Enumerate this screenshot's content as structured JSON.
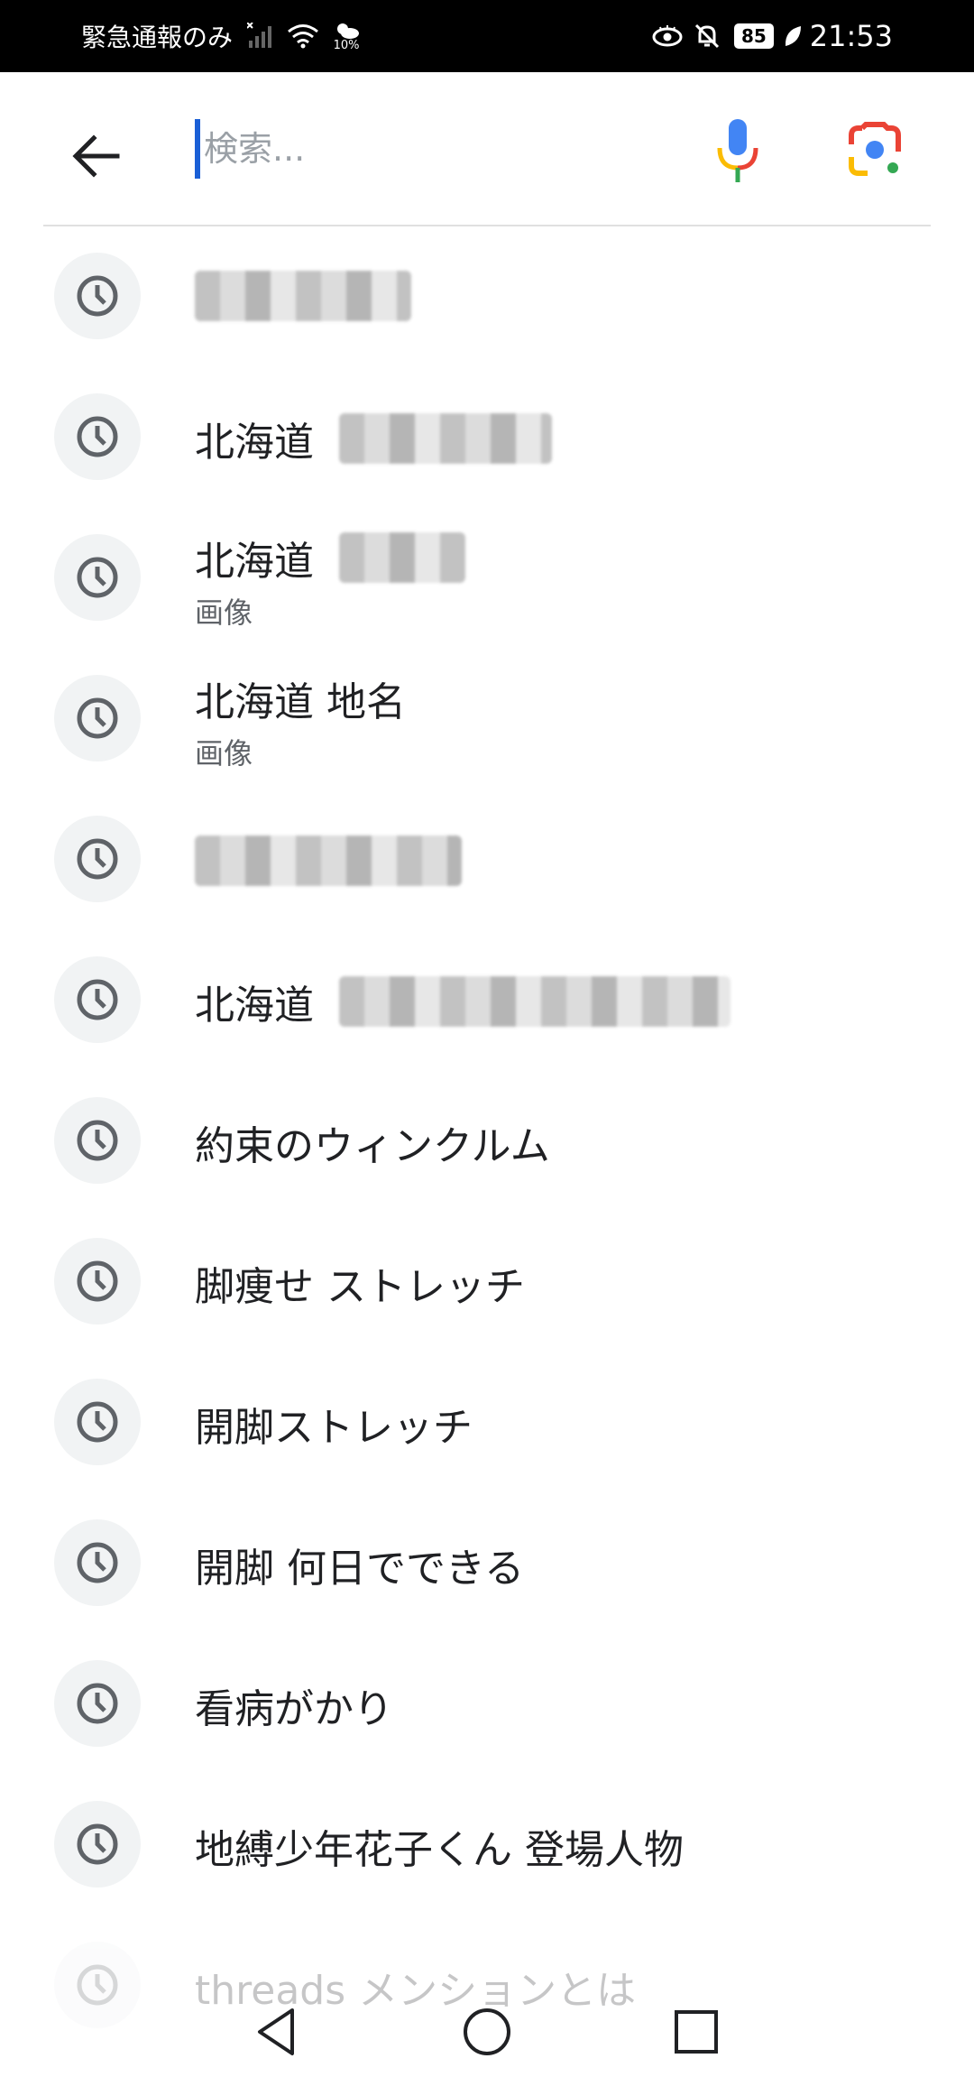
{
  "status_bar": {
    "carrier": "緊急通報のみ",
    "weather_text": "10%",
    "battery": "85",
    "time": "21:53"
  },
  "search": {
    "placeholder": "検索..."
  },
  "history": [
    {
      "text": "",
      "subtitle": ""
    },
    {
      "text": "北海道",
      "subtitle": ""
    },
    {
      "text": "北海道",
      "subtitle": "画像"
    },
    {
      "text": "北海道 地名",
      "subtitle": "画像"
    },
    {
      "text": "",
      "subtitle": ""
    },
    {
      "text": "北海道",
      "subtitle": ""
    },
    {
      "text": "約束のウィンクルム",
      "subtitle": ""
    },
    {
      "text": "脚痩せ ストレッチ",
      "subtitle": ""
    },
    {
      "text": "開脚ストレッチ",
      "subtitle": ""
    },
    {
      "text": "開脚 何日でできる",
      "subtitle": ""
    },
    {
      "text": "看病がかり",
      "subtitle": ""
    },
    {
      "text": "地縛少年花子くん 登場人物",
      "subtitle": ""
    },
    {
      "text": "threads メンションとは",
      "subtitle": ""
    }
  ],
  "icons": {
    "back": "arrow-back-icon",
    "mic": "mic-icon",
    "lens": "google-lens-icon",
    "history": "clock-icon"
  },
  "colors": {
    "caret": "#1a5fd6",
    "icon_circle": "#f1f3f4",
    "mic_blue": "#4285f4",
    "mic_red": "#ea4335",
    "mic_yellow": "#fbbc04",
    "mic_green": "#34a853"
  }
}
